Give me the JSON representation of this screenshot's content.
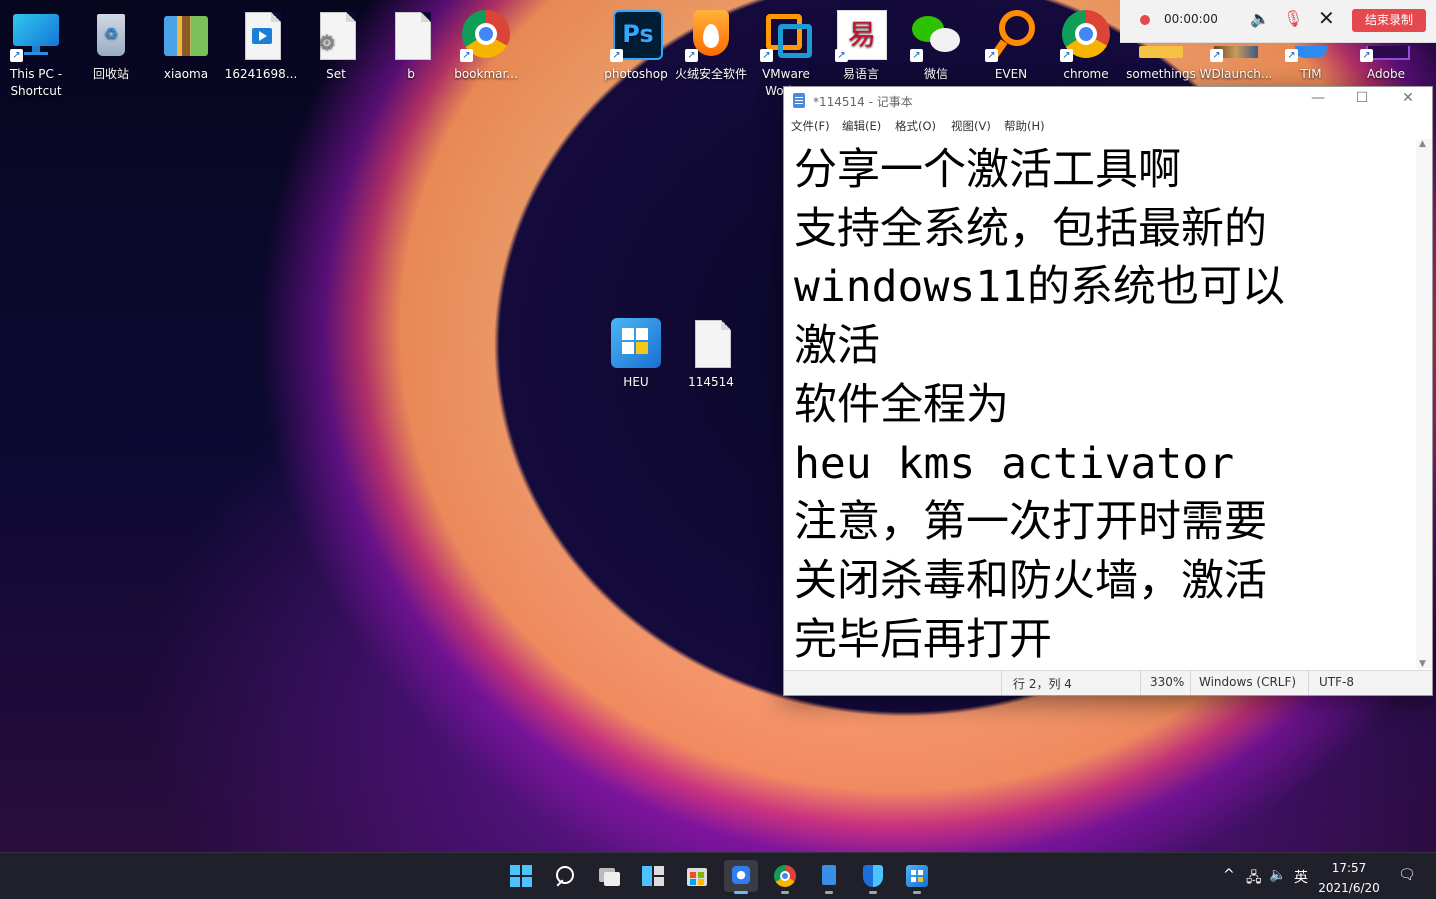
{
  "desktop_icons": [
    {
      "label": "This PC - Shortcut",
      "icon": "monitor-icon"
    },
    {
      "label": "回收站",
      "icon": "recycle-bin-icon"
    },
    {
      "label": "xiaoma",
      "icon": "archive-icon"
    },
    {
      "label": "16241698...",
      "icon": "video-file-icon"
    },
    {
      "label": "Set",
      "icon": "settings-file-icon"
    },
    {
      "label": "b",
      "icon": "blank-file-icon"
    },
    {
      "label": "bookmar...",
      "icon": "chrome-icon"
    },
    {
      "label": "photoshop",
      "icon": "photoshop-icon",
      "badge": "Ps"
    },
    {
      "label": "火绒安全软件",
      "icon": "huorong-icon"
    },
    {
      "label": "VMware Work...",
      "icon": "vmware-icon"
    },
    {
      "label": "易语言",
      "icon": "eyuyan-icon",
      "badge": "易"
    },
    {
      "label": "微信",
      "icon": "wechat-icon"
    },
    {
      "label": "EVEN",
      "icon": "everything-icon"
    },
    {
      "label": "chrome",
      "icon": "chrome-icon"
    },
    {
      "label": "somethings",
      "icon": "folder-icon"
    },
    {
      "label": "WDlaunch...",
      "icon": "game-icon"
    },
    {
      "label": "TIM",
      "icon": "tim-icon"
    },
    {
      "label": "Adobe",
      "icon": "adobe-icon"
    },
    {
      "label": "HEU",
      "icon": "heu-kms-icon"
    },
    {
      "label": "114514",
      "icon": "text-file-icon"
    }
  ],
  "recorder": {
    "time": "00:00:00",
    "stop_label": "结束录制",
    "colors": {
      "accent": "#e5484d"
    }
  },
  "notepad": {
    "title": "*114514 - 记事本",
    "menu": [
      "文件(F)",
      "编辑(E)",
      "格式(O)",
      "视图(V)",
      "帮助(H)"
    ],
    "lines": [
      "分享一个激活工具啊",
      "支持全系统，包括最新的",
      "windows11的系统也可以",
      "激活",
      "软件全程为",
      "heu kms activator",
      "注意，第一次打开时需要",
      "关闭杀毒和防火墙，激活",
      "完毕后再打开"
    ],
    "status": {
      "position": "行 2，列 4",
      "zoom": "330%",
      "line_ending": "Windows (CRLF)",
      "encoding": "UTF-8"
    }
  },
  "taskbar": {
    "apps": [
      "start-icon",
      "search-icon",
      "task-view-icon",
      "widgets-icon",
      "store-icon",
      "recorder-icon",
      "chrome-icon",
      "notepad-icon",
      "defender-icon",
      "heu-kms-icon"
    ],
    "tray_ime": "英",
    "time": "17:57",
    "date": "2021/6/20"
  }
}
